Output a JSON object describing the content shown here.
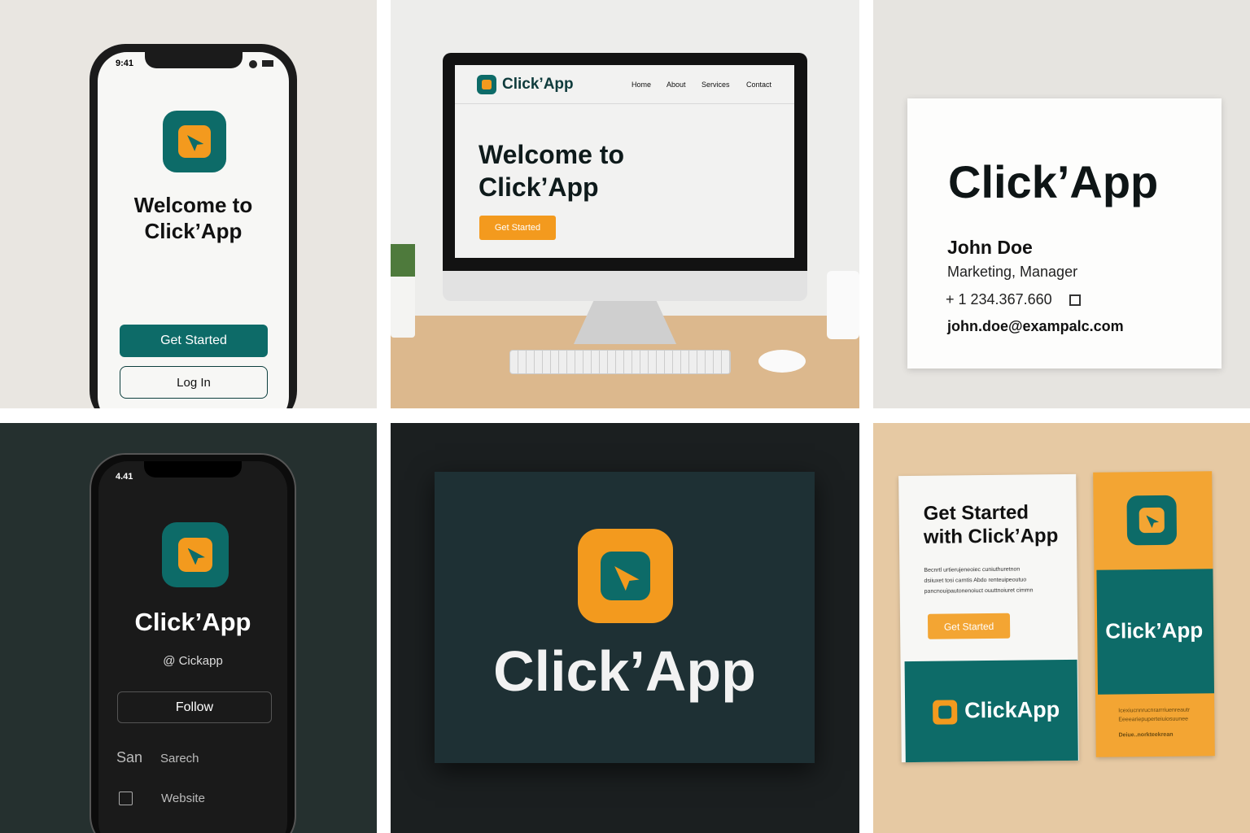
{
  "colors": {
    "teal": "#0d6b68",
    "orange": "#f39a1e",
    "dark": "#1c2a2d",
    "wood": "#e8c89f"
  },
  "phone_light": {
    "time": "9:41",
    "title_line1": "Welcome to",
    "title_line2": "Click’App",
    "primary_button": "Get Started",
    "secondary_button": "Log In",
    "icon": "click-app-logo-icon"
  },
  "desktop": {
    "brand": "Click’App",
    "nav": [
      "Home",
      "About",
      "Services",
      "Contact"
    ],
    "hero_line1": "Welcome to",
    "hero_line2": "Click’App",
    "cta": "Get Started"
  },
  "business_card": {
    "brand": "Click’App",
    "name": "John Doe",
    "role": "Marketing, Manager",
    "phone": "+ 1 234.367.660",
    "email": "john.doe@exampalc.com"
  },
  "phone_dark": {
    "time": "4.41",
    "brand": "Click’App",
    "handle": "@ Cickapp",
    "follow_button": "Follow",
    "search_prefix": "San",
    "search_label": "Sarech",
    "website_label": "Website"
  },
  "dark_card": {
    "brand": "Click’App"
  },
  "flyers": {
    "headline_line1": "Get Started",
    "headline_line2": "with Click’App",
    "body_lines": [
      "Becnrtl urtierujeneoiec cuniuthuretnon",
      "dsiiuxet tosi carntis Abdo renteuipeoutuo",
      "pancnouipautonenoiuct ouuttnoiuret cimmn"
    ],
    "cta": "Get Started",
    "footer_brand": "ClickApp",
    "bookmark_brand": "Click’App",
    "bookmark_lines": [
      "Icexiucnnrucnrarrriuenreautr",
      "Eeeeariepuperteiuiosuunee",
      "Deiue..norkteekrean"
    ]
  }
}
